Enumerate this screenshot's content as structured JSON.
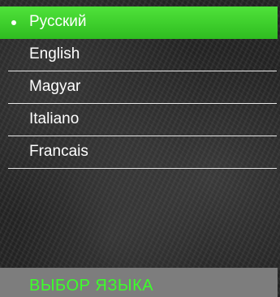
{
  "languages": [
    {
      "label": "Русский",
      "selected": true
    },
    {
      "label": "English",
      "selected": false
    },
    {
      "label": "Magyar",
      "selected": false
    },
    {
      "label": "Italiano",
      "selected": false
    },
    {
      "label": "Francais",
      "selected": false
    }
  ],
  "footer": {
    "title": "ВЫБОР ЯЗЫКА"
  },
  "colors": {
    "selection": "#3bcf2a",
    "footer_text": "#3cff2a",
    "footer_bg": "#7d7d7d"
  }
}
